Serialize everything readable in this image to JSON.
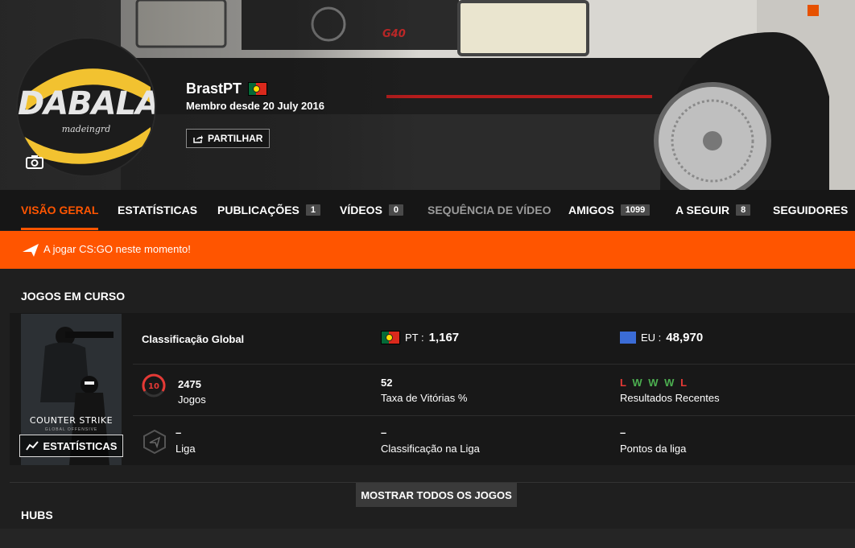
{
  "profile": {
    "username": "BrastPT",
    "member_since": "Membro desde 20 July 2016",
    "share_label": "PARTILHAR",
    "avatar_text": "DABALA",
    "avatar_subtext": "madeingrd"
  },
  "nav": {
    "items": [
      {
        "label": "VISÃO GERAL"
      },
      {
        "label": "ESTATÍSTICAS"
      },
      {
        "label": "PUBLICAÇÕES",
        "badge": "1"
      },
      {
        "label": "VÍDEOS",
        "badge": "0"
      },
      {
        "label": "SEQUÊNCIA DE VÍDEO"
      },
      {
        "label": "AMIGOS",
        "badge": "1099"
      },
      {
        "label": "A SEGUIR",
        "badge": "8"
      },
      {
        "label": "SEGUIDORES"
      }
    ],
    "active": "VISÃO GERAL"
  },
  "playing": {
    "text": "A jogar CS:GO neste momento!"
  },
  "current_games": {
    "title": "JOGOS EM CURSO",
    "cover_title": "COUNTER STRIKE",
    "cover_subtitle": "GLOBAL OFFENSIVE",
    "stats_button": "ESTATÍSTICAS",
    "global_rank_label": "Classificação Global",
    "pt_label": "PT :",
    "pt_value": "1,167",
    "eu_label": "EU :",
    "eu_value": "48,970",
    "level": "10",
    "games_value": "2475",
    "games_label": "Jogos",
    "winrate_value": "52",
    "winrate_label": "Taxa de Vitórias %",
    "recent_results": [
      "L",
      "W",
      "W",
      "W",
      "L"
    ],
    "recent_results_label": "Resultados Recentes",
    "league_value": "–",
    "league_label": "Liga",
    "league_rank_value": "–",
    "league_rank_label": "Classificação na Liga",
    "league_points_value": "–",
    "league_points_label": "Pontos da liga",
    "show_all": "MOSTRAR TODOS OS JOGOS"
  },
  "hubs": {
    "title": "HUBS"
  },
  "colors": {
    "accent": "#ff5500",
    "win": "#4caf50",
    "loss": "#e53935"
  }
}
